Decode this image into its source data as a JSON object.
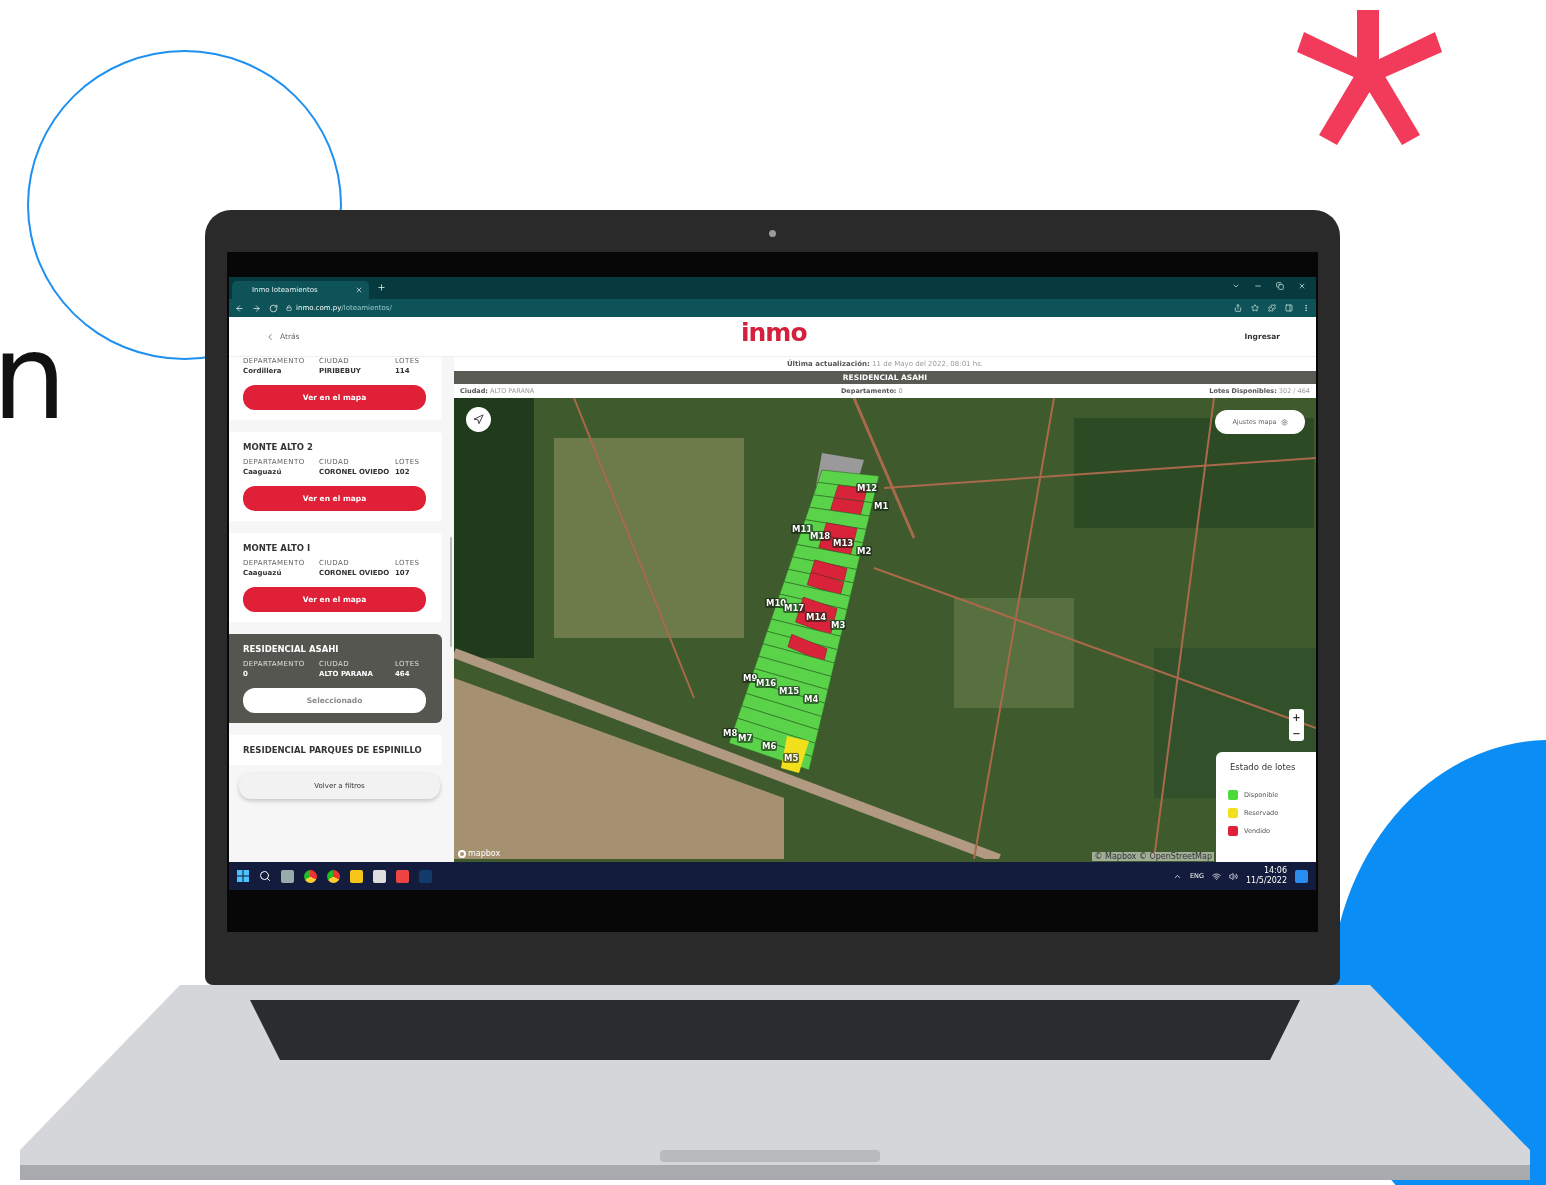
{
  "backdrop": {
    "letter": "n"
  },
  "browser": {
    "tab_title": "Inmo loteamientos",
    "url_host": "inmo.com.py",
    "url_path": "/loteamientos/"
  },
  "header": {
    "back": "Atrás",
    "logo": "inmo",
    "login": "Ingresar"
  },
  "sidebar": {
    "cards": [
      {
        "kind": "full",
        "labels": [
          "DEPARTAMENTO",
          "CIUDAD",
          "LOTES"
        ],
        "department": "Cordillera",
        "city": "PIRIBEBUY",
        "lots": "114",
        "button": "Ver en el mapa",
        "selected": false
      },
      {
        "kind": "full",
        "title": "MONTE ALTO 2",
        "labels": [
          "DEPARTAMENTO",
          "CIUDAD",
          "LOTES"
        ],
        "department": "Caaguazú",
        "city": "CORONEL OVIEDO",
        "lots": "102",
        "button": "Ver en el mapa",
        "selected": false
      },
      {
        "kind": "full",
        "title": "MONTE ALTO I",
        "labels": [
          "DEPARTAMENTO",
          "CIUDAD",
          "LOTES"
        ],
        "department": "Caaguazú",
        "city": "CORONEL OVIEDO",
        "lots": "107",
        "button": "Ver en el mapa",
        "selected": false
      },
      {
        "kind": "full",
        "title": "RESIDENCIAL ASAHI",
        "labels": [
          "DEPARTAMENTO",
          "CIUDAD",
          "LOTES"
        ],
        "department": "0",
        "city": "ALTO PARANA",
        "lots": "464",
        "button": "Seleccionado",
        "selected": true
      },
      {
        "kind": "title_only",
        "title": "RESIDENCIAL PARQUES DE ESPINILLO",
        "selected": false
      }
    ],
    "back_button": "Volver a filtros"
  },
  "map_panel": {
    "updated_label": "Última actualización:",
    "updated_value": "11 de Mayo del 2022, 08:01 hs.",
    "title": "RESIDENCIAL ASAHI",
    "city_label": "Ciudad:",
    "city": "ALTO PARANA",
    "dept_label": "Departamento:",
    "dept": "0",
    "available_label": "Lotes Disponibles:",
    "available": "302 / 464"
  },
  "map": {
    "settings_button": "Ajustes mapa",
    "block_labels": [
      "M12",
      "M1",
      "M11",
      "M18",
      "M13",
      "M2",
      "M10",
      "M17",
      "M14",
      "M3",
      "M9",
      "M16",
      "M15",
      "M4",
      "M8",
      "M7",
      "M6",
      "M5"
    ],
    "zoom_in": "+",
    "zoom_out": "−",
    "attribution_logo": "mapbox",
    "attribution": "© Mapbox © OpenStreetMap"
  },
  "legend": {
    "title": "Estado de lotes",
    "items": [
      {
        "label": "Disponible",
        "color": "#4cd93a"
      },
      {
        "label": "Reservado",
        "color": "#f2e01c"
      },
      {
        "label": "Vendido",
        "color": "#e0203a"
      }
    ]
  },
  "taskbar": {
    "language": "ENG",
    "time": "14:06",
    "date": "11/5/2022"
  }
}
